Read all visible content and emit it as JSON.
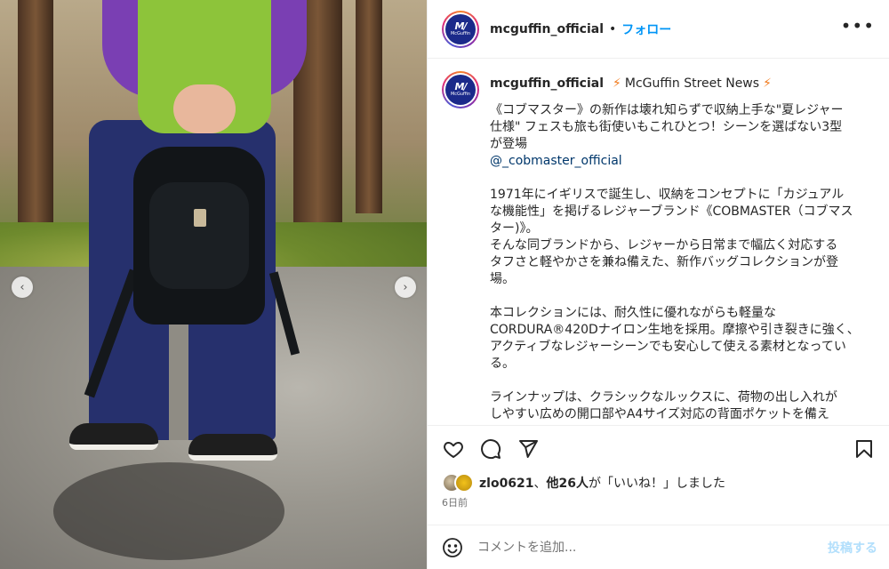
{
  "post": {
    "username": "mcguffin_official",
    "separator": "•",
    "follow_label": "フォロー",
    "more_label": "•••",
    "avatar_logo_mark": "M/",
    "avatar_logo_text": "McGuffin"
  },
  "caption": {
    "username": "mcguffin_official",
    "headline": "McGuffin Street News",
    "bolt": "⚡",
    "intro": "《コブマスター》の新作は壊れ知らずで収納上手な\"夏レジャー\n仕様\" フェスも旅も街使いもこれひとつ！シーンを選ばない3型\nが登場",
    "mention": "@_cobmaster_official",
    "paragraph1": "1971年にイギリスで誕生し、収納をコンセプトに「カジュアル\nな機能性」を掲げるレジャーブランド《COBMASTER（コブマス\nター)》。\nそんな同ブランドから、レジャーから日常まで幅広く対応する\nタフさと軽やかさを兼ね備えた、新作バッグコレクションが登\n場。",
    "paragraph2": "本コレクションには、耐久性に優れながらも軽量な\nCORDURA®420Dナイロン生地を採用。摩擦や引き裂きに強く、\nアクティブなレジャーシーンでも安心して使える素材となってい\nる。",
    "paragraph3": "ラインナップは、クラシックなルックスに、荷物の出し入れが\nしやすい広めの開口部やA4サイズ対応の背面ポケットを備え"
  },
  "actions": {
    "like_icon": "heart-icon",
    "comment_icon": "comment-icon",
    "share_icon": "send-icon",
    "save_icon": "bookmark-icon"
  },
  "likes": {
    "user": "zlo0621",
    "middle": "、",
    "others": "他26人",
    "suffix": "が「いいね！」しました"
  },
  "time": "6日前",
  "comment": {
    "placeholder": "コメントを追加...",
    "post_label": "投稿する"
  },
  "carousel": {
    "prev_glyph": "‹",
    "next_glyph": "›"
  },
  "colors": {
    "accent": "#0095f6",
    "post_disabled": "#b2dffc",
    "mention": "#00376b",
    "bolt": "#f17a1c",
    "brand": "#1b2a8a"
  }
}
